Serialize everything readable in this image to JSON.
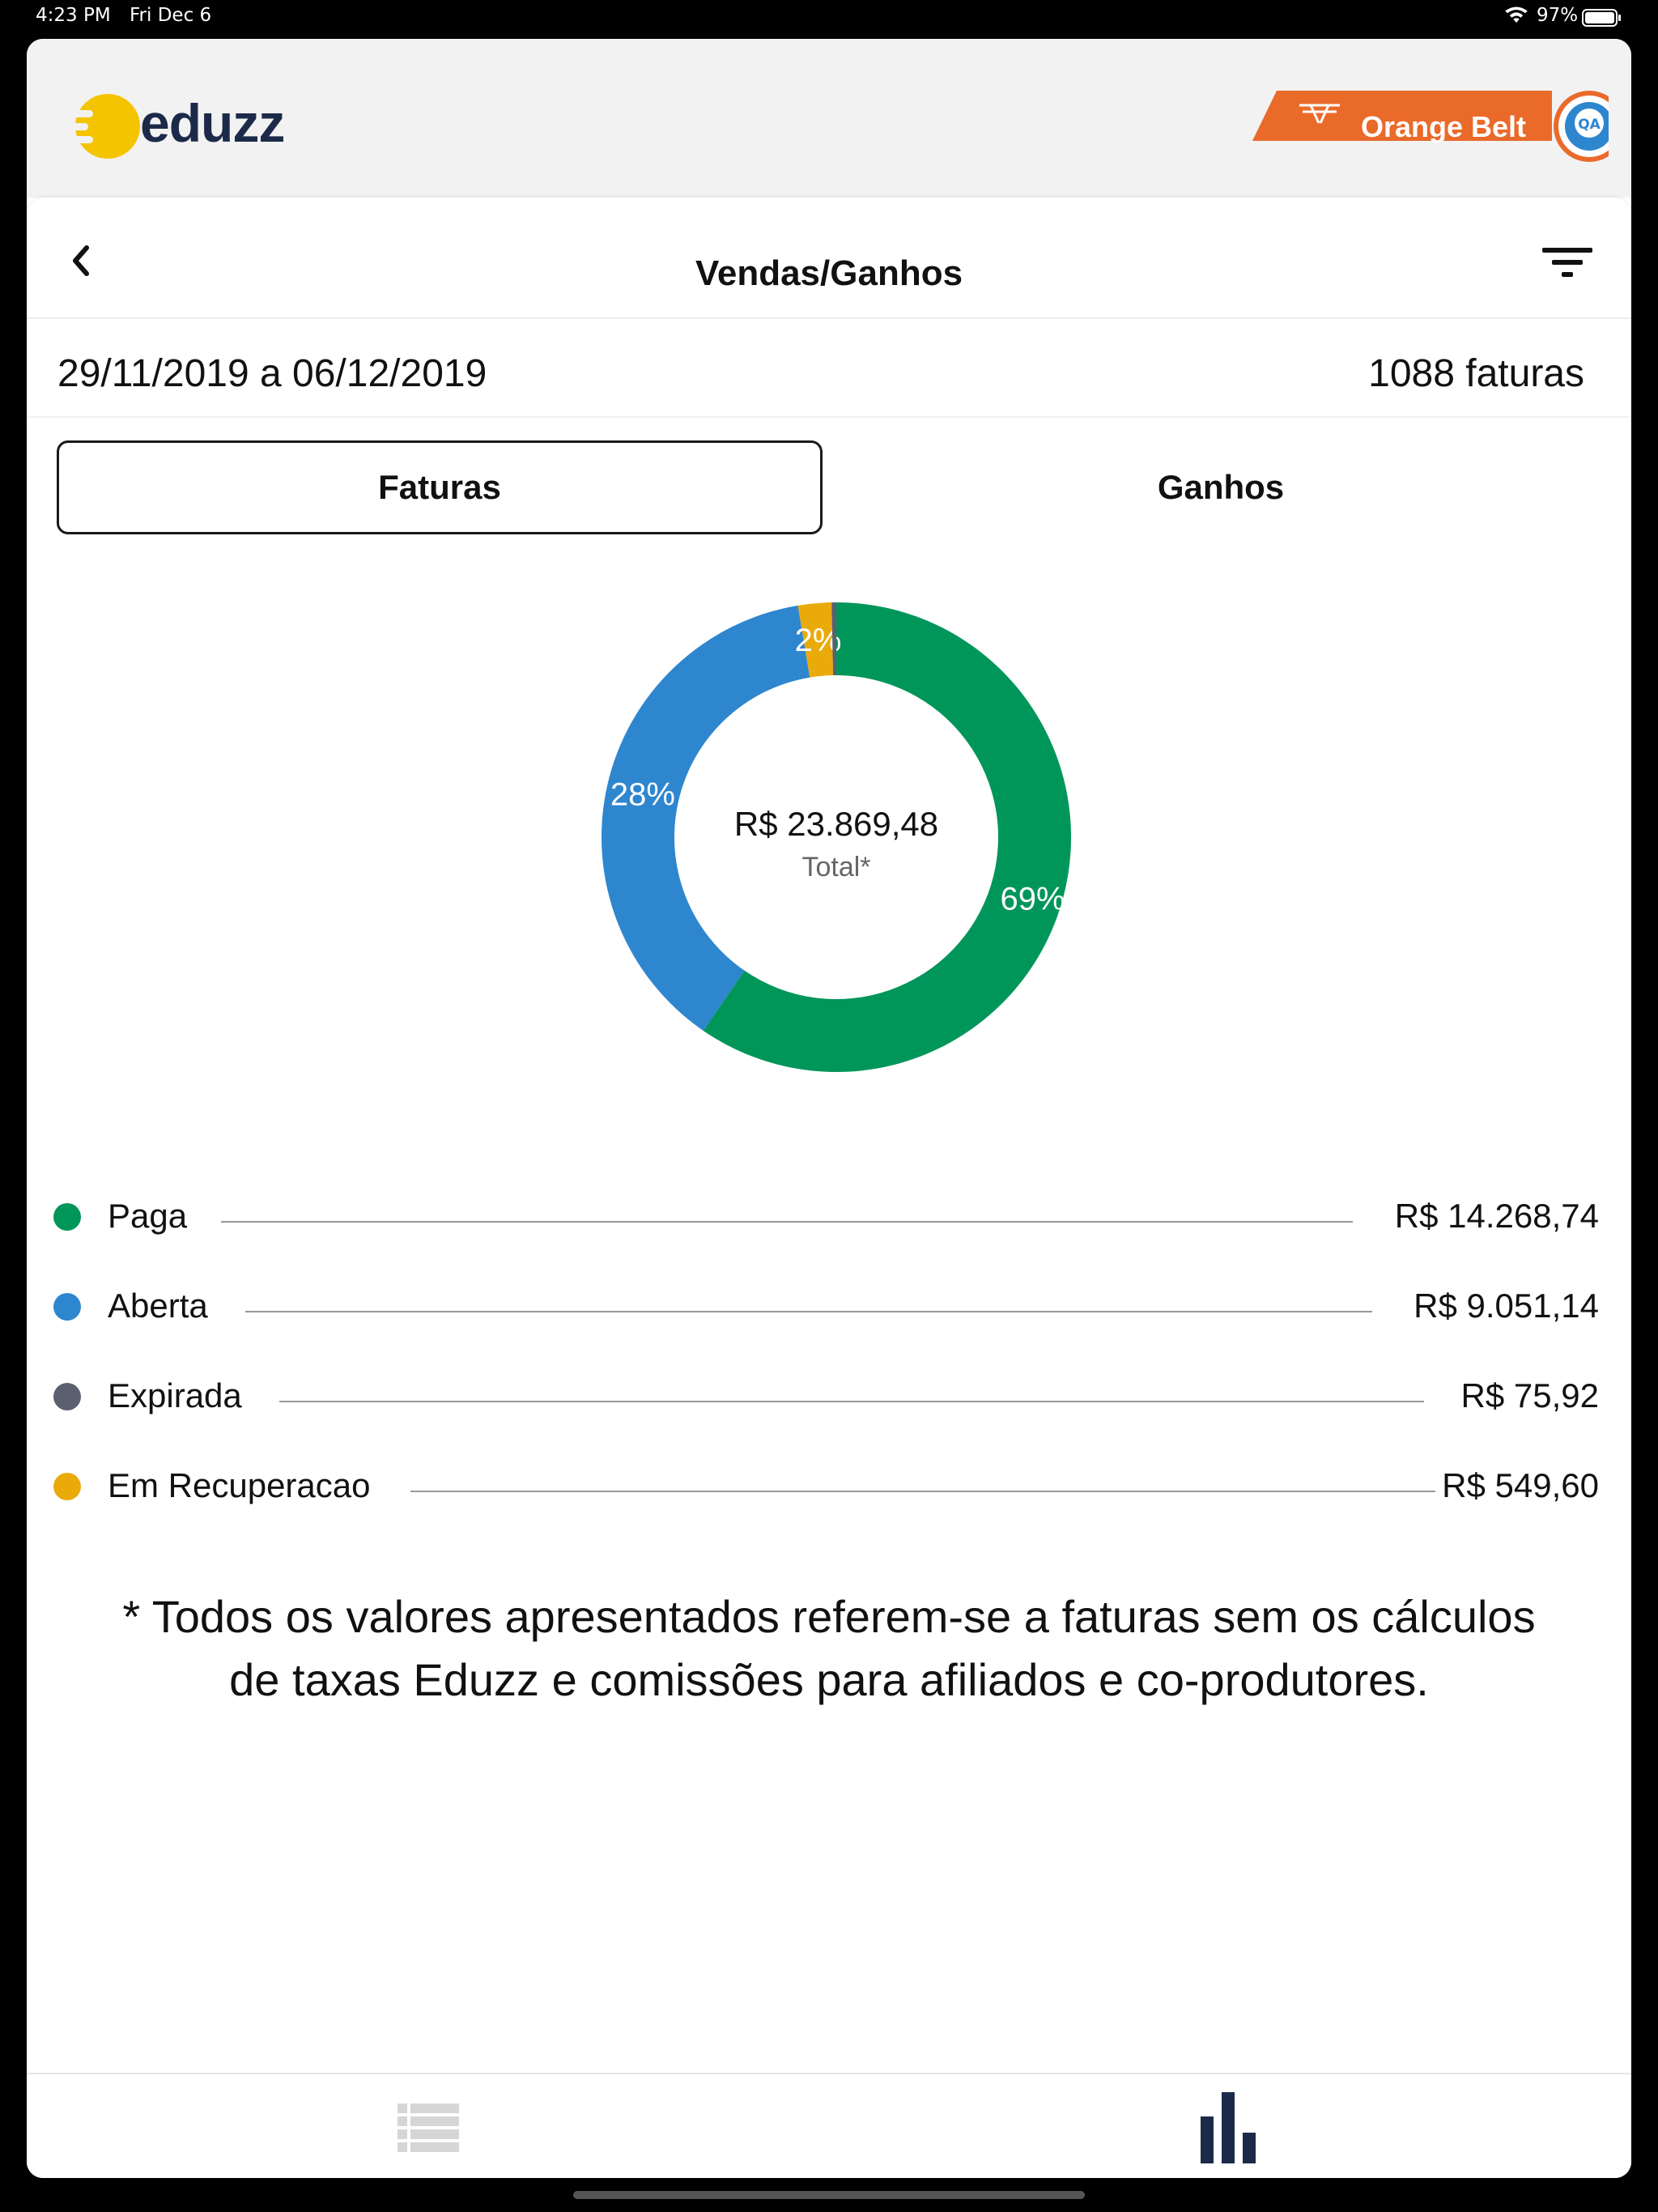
{
  "status_bar": {
    "time": "4:23 PM",
    "date": "Fri Dec 6",
    "battery": "97%",
    "icons": [
      "wifi-icon",
      "battery-icon"
    ]
  },
  "header": {
    "logo_text": "eduzz",
    "badge_label": "Orange Belt",
    "badge_seal_text": "QA",
    "icons": [
      "eduzz-logo-icon",
      "belt-icon",
      "qa-seal-icon"
    ]
  },
  "nav": {
    "title": "Vendas/Ganhos",
    "icons": [
      "back-chevron-icon",
      "filter-icon"
    ]
  },
  "summary": {
    "date_range": "29/11/2019 a 06/12/2019",
    "invoice_count": "1088 faturas"
  },
  "tabs": [
    {
      "label": "Faturas",
      "selected": true
    },
    {
      "label": "Ganhos",
      "selected": false
    }
  ],
  "colors": {
    "paga": "#00965a",
    "aberta": "#2e86cf",
    "expirada": "#5a6070",
    "em_recuperacao": "#eaaa0a",
    "badge_orange": "#ea6a2a",
    "logo_yellow": "#f5c400",
    "logo_navy": "#1c2a4a"
  },
  "chart_data": {
    "type": "pie",
    "center_value": "R$ 23.869,48",
    "center_label": "Total*",
    "slices": [
      {
        "name": "Paga",
        "value": 14268.74,
        "display": "R$ 14.268,74",
        "label": "69%",
        "color": "#00965a"
      },
      {
        "name": "Aberta",
        "value": 9051.14,
        "display": "R$ 9.051,14",
        "label": "28%",
        "color": "#2e86cf"
      },
      {
        "name": "Expirada",
        "value": 75.92,
        "display": "R$ 75,92",
        "label": "",
        "color": "#5a6070"
      },
      {
        "name": "Em Recuperacao",
        "value": 549.6,
        "display": "R$ 549,60",
        "label": "2%",
        "color": "#eaaa0a"
      }
    ]
  },
  "legend": [
    {
      "label": "Paga",
      "value": "R$ 14.268,74"
    },
    {
      "label": "Aberta",
      "value": "R$ 9.051,14"
    },
    {
      "label": "Expirada",
      "value": "R$ 75,92"
    },
    {
      "label": "Em Recuperacao",
      "value": "R$ 549,60"
    }
  ],
  "disclaimer": {
    "line1": "* Todos os valores apresentados referem-se a faturas sem os cálculos",
    "line2": "de taxas Eduzz e comissões para afiliados e co-produtores."
  },
  "bottom_tabs": [
    {
      "icon": "list-icon",
      "selected": false
    },
    {
      "icon": "bar-chart-icon",
      "selected": true
    }
  ]
}
